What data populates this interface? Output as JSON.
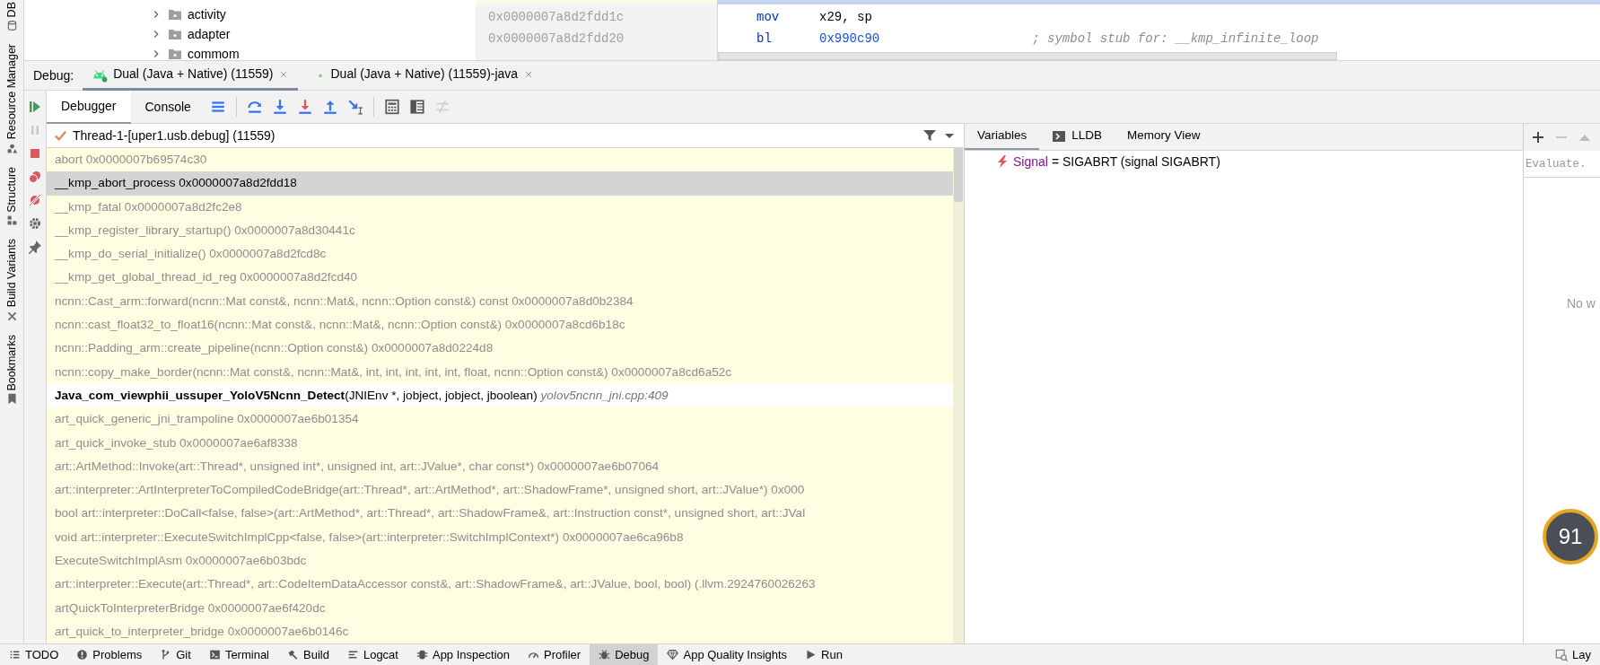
{
  "side_strip": [
    {
      "label": "DB",
      "kind": "db"
    },
    {
      "label": "Resource Manager",
      "kind": "resources"
    },
    {
      "label": "Structure",
      "kind": "structure"
    },
    {
      "label": "Build Variants",
      "kind": "variants"
    },
    {
      "label": "Bookmarks",
      "kind": "bookmark"
    }
  ],
  "project_tree": [
    {
      "label": "activity",
      "expanded": false
    },
    {
      "label": "adapter",
      "expanded": false
    },
    {
      "label": "commom",
      "expanded": false
    }
  ],
  "disassembly": {
    "addresses": [
      "0x0000007a8d2fdd1c",
      "0x0000007a8d2fdd20"
    ],
    "lines": [
      {
        "mnemonic": "mov",
        "operands": "x29, sp"
      },
      {
        "mnemonic": "bl",
        "operands": "0x990c90",
        "comment": "; symbol stub for: __kmp_infinite_loop"
      }
    ]
  },
  "debug_bar": {
    "label": "Debug:",
    "tabs": [
      {
        "label": "Dual (Java + Native) (11559)",
        "kind": "android",
        "selected": true
      },
      {
        "label": "Dual (Java + Native) (11559)-java",
        "kind": "dot",
        "selected": false
      }
    ]
  },
  "actions": [
    {
      "kind": "resume",
      "disabled": false
    },
    {
      "kind": "pause",
      "disabled": true
    },
    {
      "kind": "stop",
      "disabled": false
    },
    {
      "kind": "breakpoints",
      "disabled": false
    },
    {
      "kind": "mute",
      "disabled": false
    },
    {
      "kind": "settings",
      "disabled": false
    },
    {
      "kind": "pin",
      "disabled": false
    }
  ],
  "debugger_tabs": [
    {
      "label": "Debugger",
      "selected": true
    },
    {
      "label": "Console",
      "selected": false
    }
  ],
  "toolbar": [
    {
      "kind": "menu",
      "disabled": false
    },
    {
      "kind": "step-over",
      "disabled": false
    },
    {
      "kind": "step-into",
      "disabled": false
    },
    {
      "kind": "force-step-into",
      "disabled": false
    },
    {
      "kind": "step-out",
      "disabled": false
    },
    {
      "kind": "run-to-cursor",
      "disabled": false
    },
    {
      "kind": "calculator",
      "disabled": false
    },
    {
      "kind": "table",
      "disabled": false
    },
    {
      "kind": "trace",
      "disabled": true
    }
  ],
  "thread": {
    "label": "Thread-1-[uper1.usb.debug] (11559)"
  },
  "frames": [
    {
      "text": "abort 0x0000007b69574c30",
      "kind": "native",
      "selected": false
    },
    {
      "text": "__kmp_abort_process 0x0000007a8d2fdd18",
      "kind": "native",
      "selected": true
    },
    {
      "text": "__kmp_fatal 0x0000007a8d2fc2e8",
      "kind": "native",
      "selected": false
    },
    {
      "text": "__kmp_register_library_startup() 0x0000007a8d30441c",
      "kind": "native",
      "selected": false
    },
    {
      "text": "__kmp_do_serial_initialize() 0x0000007a8d2fcd8c",
      "kind": "native",
      "selected": false
    },
    {
      "text": "__kmp_get_global_thread_id_reg 0x0000007a8d2fcd40",
      "kind": "native",
      "selected": false
    },
    {
      "text": "ncnn::Cast_arm::forward(ncnn::Mat const&, ncnn::Mat&, ncnn::Option const&) const 0x0000007a8d0b2384",
      "kind": "native",
      "selected": false
    },
    {
      "text": "ncnn::cast_float32_to_float16(ncnn::Mat const&, ncnn::Mat&, ncnn::Option const&) 0x0000007a8cd6b18c",
      "kind": "native",
      "selected": false
    },
    {
      "text": "ncnn::Padding_arm::create_pipeline(ncnn::Option const&) 0x0000007a8d0224d8",
      "kind": "native",
      "selected": false
    },
    {
      "text": "ncnn::copy_make_border(ncnn::Mat const&, ncnn::Mat&, int, int, int, int, int, float, ncnn::Option const&) 0x0000007a8cd6a52c",
      "kind": "native",
      "selected": false
    },
    {
      "text": "**Java_com_viewphii_ussuper_YoloV5Ncnn_Detect**(JNIEnv *, jobject, jobject, jboolean) *yolov5ncnn_jni.cpp:409*",
      "kind": "source",
      "selected": false
    },
    {
      "text": "art_quick_generic_jni_trampoline 0x0000007ae6b01354",
      "kind": "native",
      "selected": false
    },
    {
      "text": "art_quick_invoke_stub 0x0000007ae6af8338",
      "kind": "native",
      "selected": false
    },
    {
      "text": "art::ArtMethod::Invoke(art::Thread*, unsigned int*, unsigned int, art::JValue*, char const*) 0x0000007ae6b07064",
      "kind": "native",
      "selected": false
    },
    {
      "text": "art::interpreter::ArtInterpreterToCompiledCodeBridge(art::Thread*, art::ArtMethod*, art::ShadowFrame*, unsigned short, art::JValue*) 0x000",
      "kind": "native",
      "selected": false
    },
    {
      "text": "bool art::interpreter::DoCall<false, false>(art::ArtMethod*, art::Thread*, art::ShadowFrame&, art::Instruction const*, unsigned short, art::JVal",
      "kind": "native",
      "selected": false
    },
    {
      "text": "void art::interpreter::ExecuteSwitchImplCpp<false, false>(art::interpreter::SwitchImplContext*) 0x0000007ae6ca96b8",
      "kind": "native",
      "selected": false
    },
    {
      "text": "ExecuteSwitchImplAsm 0x0000007ae6b03bdc",
      "kind": "native",
      "selected": false
    },
    {
      "text": "art::interpreter::Execute(art::Thread*, art::CodeItemDataAccessor const&, art::ShadowFrame&, art::JValue, bool, bool) (.llvm.2924760026263",
      "kind": "native",
      "selected": false
    },
    {
      "text": "artQuickToInterpreterBridge 0x0000007ae6f420dc",
      "kind": "native",
      "selected": false
    },
    {
      "text": "art_quick_to_interpreter_bridge 0x0000007ae6b0146c",
      "kind": "native",
      "selected": false
    }
  ],
  "variables_tabs": [
    {
      "label": "Variables",
      "kind": "plain",
      "selected": true
    },
    {
      "label": "LLDB",
      "kind": "console",
      "selected": false
    },
    {
      "label": "Memory View",
      "kind": "plain",
      "selected": false
    }
  ],
  "variables": [
    {
      "name": "Signal",
      "value": "= SIGABRT (signal SIGABRT)"
    }
  ],
  "watches": {
    "placeholder": "Evaluate.",
    "empty_text": "No w"
  },
  "overlay_badge": {
    "label": "91"
  },
  "tool_windows": [
    {
      "label": "TODO",
      "kind": "list",
      "selected": false
    },
    {
      "label": "Problems",
      "kind": "problems",
      "selected": false
    },
    {
      "label": "Git",
      "kind": "git",
      "selected": false
    },
    {
      "label": "Terminal",
      "kind": "terminal",
      "selected": false
    },
    {
      "label": "Build",
      "kind": "hammer",
      "selected": false
    },
    {
      "label": "Logcat",
      "kind": "logcat",
      "selected": false
    },
    {
      "label": "App Inspection",
      "kind": "inspection",
      "selected": false
    },
    {
      "label": "Profiler",
      "kind": "gauge",
      "selected": false
    },
    {
      "label": "Debug",
      "kind": "bug",
      "selected": true
    },
    {
      "label": "App Quality Insights",
      "kind": "diamond",
      "selected": false
    },
    {
      "label": "Run",
      "kind": "play",
      "selected": false
    }
  ],
  "right_tool_windows": [
    {
      "label": "Lay",
      "kind": "layout"
    }
  ]
}
